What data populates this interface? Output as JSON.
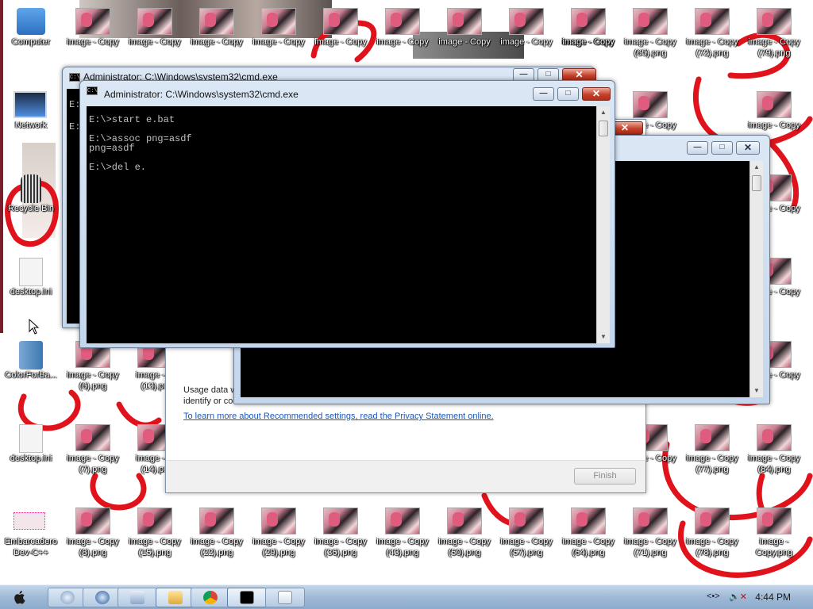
{
  "desktop": {
    "icons": [
      {
        "label": "Computer",
        "icon": "computer-icon",
        "kind": "computer"
      },
      {
        "label": "Network",
        "icon": "network-icon",
        "kind": "network"
      },
      {
        "label": "Recycle Bin",
        "icon": "recycle-bin-icon",
        "kind": "bin"
      },
      {
        "label": "desktop.ini",
        "icon": "file-icon",
        "kind": "file"
      },
      {
        "label": "ColorForBa...",
        "icon": "folder-icon",
        "kind": "folder"
      },
      {
        "label": "desktop.ini",
        "icon": "file-icon",
        "kind": "file"
      },
      {
        "label": "Embarcadero Dev-C++",
        "icon": "app-icon",
        "kind": "embar"
      },
      {
        "label": "image - Copy",
        "icon": "image-thumbnail-icon",
        "kind": "thumb"
      },
      {
        "label": "image - Copy",
        "icon": "image-thumbnail-icon",
        "kind": "thumb"
      },
      {
        "label": "image - Copy",
        "icon": "image-thumbnail-icon",
        "kind": "thumb"
      },
      {
        "label": "image - Copy",
        "icon": "image-thumbnail-icon",
        "kind": "thumb"
      },
      {
        "label": "image - Copy",
        "icon": "image-thumbnail-icon",
        "kind": "thumb"
      },
      {
        "label": "image - Copy",
        "icon": "image-thumbnail-icon",
        "kind": "thumb"
      },
      {
        "label": "image - Copy",
        "icon": "image-thumbnail-icon",
        "kind": "thumb"
      },
      {
        "label": "image - Copy",
        "icon": "image-thumbnail-icon",
        "kind": "thumb"
      },
      {
        "label": "image - Copy",
        "icon": "image-thumbnail-icon",
        "kind": "thumb"
      },
      {
        "label": "image - Copy",
        "icon": "image-thumbnail-icon",
        "kind": "thumb"
      },
      {
        "label": "image - Copy (65).png",
        "icon": "image-thumbnail-icon",
        "kind": "thumb"
      },
      {
        "label": "image - Copy (72).png",
        "icon": "image-thumbnail-icon",
        "kind": "thumb"
      },
      {
        "label": "image - Copy (79).png",
        "icon": "image-thumbnail-icon",
        "kind": "thumb"
      },
      {
        "label": "image - Copy",
        "icon": "image-thumbnail-icon",
        "kind": "thumb"
      },
      {
        "label": "image - Copy (6).png",
        "icon": "image-thumbnail-icon",
        "kind": "thumb"
      },
      {
        "label": "image - C (13).pn",
        "icon": "image-thumbnail-icon",
        "kind": "thumb"
      },
      {
        "label": "image - Copy",
        "icon": "image-thumbnail-icon",
        "kind": "thumb"
      },
      {
        "label": "image - Copy",
        "icon": "image-thumbnail-icon",
        "kind": "thumb"
      },
      {
        "label": "image - Copy",
        "icon": "image-thumbnail-icon",
        "kind": "thumb"
      },
      {
        "label": "image - Copy",
        "icon": "image-thumbnail-icon",
        "kind": "thumb"
      },
      {
        "label": "image - Copy (7).png",
        "icon": "image-thumbnail-icon",
        "kind": "thumb"
      },
      {
        "label": "image - C (14).pn",
        "icon": "image-thumbnail-icon",
        "kind": "thumb"
      },
      {
        "label": "image - Copy",
        "icon": "image-thumbnail-icon",
        "kind": "thumb"
      },
      {
        "label": "image - Copy (77).png",
        "icon": "image-thumbnail-icon",
        "kind": "thumb"
      },
      {
        "label": "image - Copy (84).png",
        "icon": "image-thumbnail-icon",
        "kind": "thumb"
      },
      {
        "label": "image - Copy (8).png",
        "icon": "image-thumbnail-icon",
        "kind": "thumb"
      },
      {
        "label": "image - Copy (15).png",
        "icon": "image-thumbnail-icon",
        "kind": "thumb"
      },
      {
        "label": "image - Copy (22).png",
        "icon": "image-thumbnail-icon",
        "kind": "thumb"
      },
      {
        "label": "image - Copy (29).png",
        "icon": "image-thumbnail-icon",
        "kind": "thumb"
      },
      {
        "label": "image - Copy (36).png",
        "icon": "image-thumbnail-icon",
        "kind": "thumb"
      },
      {
        "label": "image - Copy (43).png",
        "icon": "image-thumbnail-icon",
        "kind": "thumb"
      },
      {
        "label": "image - Copy (50).png",
        "icon": "image-thumbnail-icon",
        "kind": "thumb"
      },
      {
        "label": "image - Copy (57).png",
        "icon": "image-thumbnail-icon",
        "kind": "thumb"
      },
      {
        "label": "image - Copy (64).png",
        "icon": "image-thumbnail-icon",
        "kind": "thumb"
      },
      {
        "label": "image - Copy (71).png",
        "icon": "image-thumbnail-icon",
        "kind": "thumb"
      },
      {
        "label": "image - Copy (78).png",
        "icon": "image-thumbnail-icon",
        "kind": "thumb"
      },
      {
        "label": "image - Copy.png",
        "icon": "image-thumbnail-icon",
        "kind": "thumb"
      }
    ]
  },
  "back_cmd": {
    "title": "Administrator: C:\\Windows\\system32\\cmd.exe",
    "console_text": "E:\nE:"
  },
  "settings_dialog": {
    "usage_text": "Usage data w\nidentify or co",
    "privacy_link": "To learn more about Recommended settings, read the Privacy Statement online.",
    "finish_label": "Finish"
  },
  "middle_cmd": {
    "title": "",
    "console_text": ""
  },
  "front_cmd": {
    "title": "Administrator: C:\\Windows\\system32\\cmd.exe",
    "console_text": "E:\\>start e.bat\n\nE:\\>assoc png=asdf\npng=asdf\n\nE:\\>del e."
  },
  "window_controls": {
    "minimize": "—",
    "maximize": "□",
    "close": "✕"
  },
  "taskbar": {
    "items": [
      {
        "icon": "apple-start-icon"
      },
      {
        "icon": "system-orb-icon"
      },
      {
        "icon": "search-q-icon"
      },
      {
        "icon": "explorer-icon"
      },
      {
        "icon": "folder-app-icon"
      },
      {
        "icon": "chrome-icon"
      },
      {
        "icon": "cmd-icon"
      },
      {
        "icon": "window-icon"
      }
    ],
    "tray_arrows": "<•>",
    "clock": "4:44 PM"
  },
  "colors": {
    "scribble": "#e0121b",
    "console_bg": "#000000",
    "console_fg": "#c0c0c0",
    "link": "#1a56b8"
  }
}
